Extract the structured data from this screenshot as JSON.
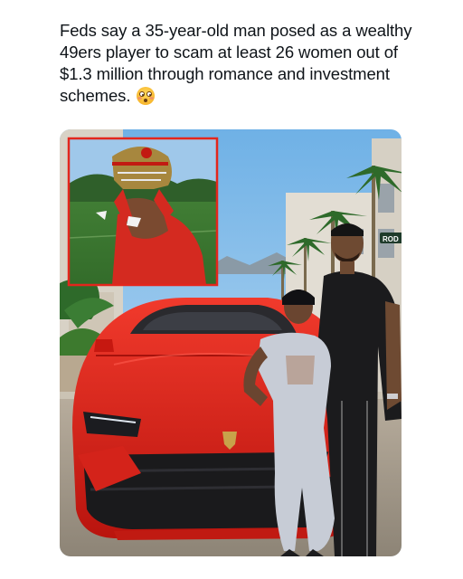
{
  "post": {
    "text": "Feds say a 35-year-old man posed as a wealthy 49ers player to scam at least 26 women out of $1.3 million through romance and investment schemes.",
    "emoji": "flushed-face-emoji"
  },
  "photo": {
    "street_sign_text": "ROD",
    "accent_red": "#e3261c",
    "sky_blue": "#8fc4ea"
  }
}
